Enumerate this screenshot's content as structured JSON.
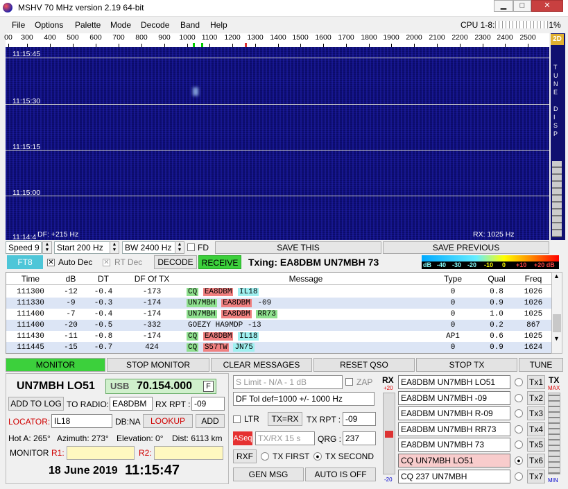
{
  "window": {
    "title": "MSHV 70 MHz version 2.19 64-bit",
    "buttons": [
      "▁",
      "□",
      "✕"
    ]
  },
  "menu": [
    "File",
    "Options",
    "Palette",
    "Mode",
    "Decode",
    "Band",
    "Help"
  ],
  "cpu": {
    "label": "CPU 1-8:",
    "value": "1%"
  },
  "ruler": {
    "ticks": [
      "00",
      "300",
      "400",
      "500",
      "600",
      "700",
      "800",
      "900",
      "1000",
      "1100",
      "1200",
      "1300",
      "1400",
      "1500",
      "1600",
      "1700",
      "1800",
      "1900",
      "2000",
      "2100",
      "2200",
      "2300",
      "2400",
      "2500"
    ]
  },
  "waterfall": {
    "times": [
      "11:15:45",
      "11:15:30",
      "11:15:15",
      "11:15:00",
      "11:14:4"
    ],
    "df": "DF: +215 Hz",
    "rx": "RX: 1025 Hz",
    "side_mode": "2D",
    "side_letters": [
      "T",
      "U",
      "N",
      "E",
      "",
      "D",
      "I",
      "S",
      "P"
    ]
  },
  "controls": {
    "speed": "Speed 9",
    "start": "Start 200 Hz",
    "bw": "BW 2400 Hz",
    "fd": "FD",
    "save_this": "SAVE THIS",
    "save_previous": "SAVE PREVIOUS"
  },
  "mode": {
    "ft8": "FT8",
    "auto_dec": "Auto Dec",
    "rt_dec": "RT Dec",
    "decode": "DECODE",
    "receive": "RECEIVE",
    "txing": "Txing: EA8DBM UN7MBH 73",
    "db_scale": [
      "dB",
      "-40",
      "-30",
      "-20",
      "-10",
      "0",
      "+10",
      "+20 dB"
    ]
  },
  "table": {
    "headers": [
      "Time",
      "dB",
      "DT",
      "DF Of TX",
      "Message",
      "Type",
      "Qual",
      "Freq"
    ],
    "rows": [
      {
        "time": "111300",
        "db": "-12",
        "dt": "-0.4",
        "df": "-173",
        "msg": [
          [
            "CQ",
            "green"
          ],
          [
            "EA8DBM",
            "red"
          ],
          [
            "IL18",
            "cyan"
          ]
        ],
        "type": "0",
        "qual": "0.8",
        "freq": "1026"
      },
      {
        "time": "111330",
        "db": "-9",
        "dt": "-0.3",
        "df": "-174",
        "msg": [
          [
            "UN7MBH",
            "green"
          ],
          [
            "EA8DBM",
            "red"
          ],
          [
            "-09",
            ""
          ]
        ],
        "type": "0",
        "qual": "0.9",
        "freq": "1026"
      },
      {
        "time": "111400",
        "db": "-7",
        "dt": "-0.4",
        "df": "-174",
        "msg": [
          [
            "UN7MBH",
            "green"
          ],
          [
            "EA8DBM",
            "red"
          ],
          [
            "RR73",
            "green"
          ]
        ],
        "type": "0",
        "qual": "1.0",
        "freq": "1025"
      },
      {
        "time": "111400",
        "db": "-20",
        "dt": "-0.5",
        "df": "-332",
        "msg": [
          [
            "GOEZY HA9MDP -13",
            ""
          ]
        ],
        "type": "0",
        "qual": "0.2",
        "freq": "867"
      },
      {
        "time": "111430",
        "db": "-11",
        "dt": "-0.8",
        "df": "-174",
        "msg": [
          [
            "CQ",
            "green"
          ],
          [
            "EA8DBM",
            "red"
          ],
          [
            "IL18",
            "cyan"
          ]
        ],
        "type": "AP1",
        "qual": "0.6",
        "freq": "1025"
      },
      {
        "time": "111445",
        "db": "-15",
        "dt": "-0.7",
        "df": "424",
        "msg": [
          [
            "CQ",
            "green"
          ],
          [
            "S57TW",
            "red"
          ],
          [
            "JN75",
            "cyan"
          ]
        ],
        "type": "0",
        "qual": "0.9",
        "freq": "1624"
      }
    ]
  },
  "buttons": {
    "monitor": "MONITOR",
    "stop_monitor": "STOP MONITOR",
    "clear_messages": "CLEAR MESSAGES",
    "reset_qso": "RESET QSO",
    "stop_tx": "STOP TX",
    "tune": "TUNE"
  },
  "station": {
    "callsign": "UN7MBH LO51",
    "mode": "USB",
    "freq": "70.154.000",
    "f": "F",
    "add_to_log": "ADD TO LOG",
    "to_radio": "TO RADIO:",
    "to_radio_value": "EA8DBM",
    "rx_rpt": "RX RPT :",
    "rx_rpt_value": "-09",
    "locator_label": "LOCATOR:",
    "locator_value": "IL18",
    "db_na": "DB:NA",
    "lookup": "LOOKUP",
    "add": "ADD",
    "hot_a": "Hot A: 265°",
    "azimuth": "Azimuth: 273°",
    "elevation": "Elevation: 0°",
    "dist": "Dist: 6113 km",
    "monitor_label": "MONITOR",
    "r1": "R1:",
    "r2": "R2:",
    "date": "18 June 2019",
    "time": "11:15:47"
  },
  "tx": {
    "s_limit": "S Limit - N/A - 1 dB",
    "zap": "ZAP",
    "df_tol": "DF Tol def=1000 +/- 1000 Hz",
    "ltr": "LTR",
    "tx_rx": "TX=RX",
    "tx_rpt": "TX RPT :",
    "tx_rpt_value": "-09",
    "aseq": "ASeq",
    "tx_rx_15": "TX/RX 15 s",
    "qrg": "QRG :",
    "qrg_value": "237",
    "rxf": "RXF",
    "tx_first": "TX FIRST",
    "tx_second": "TX SECOND",
    "gen_msg": "GEN MSG",
    "auto_off": "AUTO IS OFF",
    "rx_label": "RX",
    "rx_top": "+20",
    "rx_bottom": "-20",
    "tx_label": "TX",
    "max": "MAX",
    "min": "MIN",
    "messages": [
      "EA8DBM UN7MBH LO51",
      "EA8DBM UN7MBH -09",
      "EA8DBM UN7MBH R-09",
      "EA8DBM UN7MBH RR73",
      "EA8DBM UN7MBH 73",
      "CQ UN7MBH LO51",
      "CQ 237 UN7MBH"
    ],
    "tx_buttons": [
      "Tx1",
      "Tx2",
      "Tx3",
      "Tx4",
      "Tx5",
      "Tx6",
      "Tx7"
    ],
    "selected": 5
  },
  "colors": {
    "green": "#8ee08e",
    "red": "#f08080",
    "cyan": "#9ff0f0",
    "pink": "#f8cccc"
  }
}
